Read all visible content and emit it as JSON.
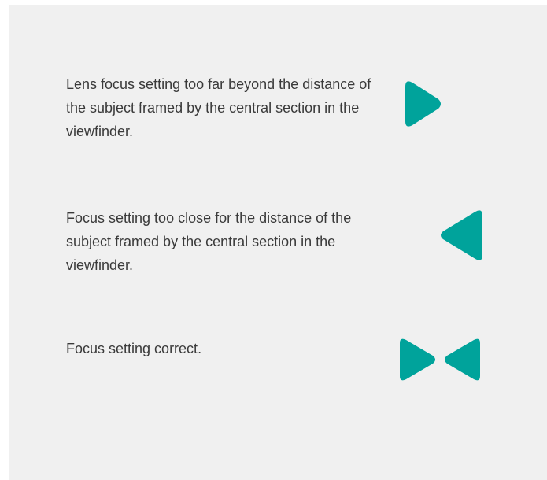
{
  "accent_color": "#00a39b",
  "items": [
    {
      "text": "Lens focus setting too far beyond the distance of the subject framed by the central section in the viewfinder.",
      "indicator": "triangle-right-icon"
    },
    {
      "text": "Focus setting too close for the distance of the subject framed by the central section in the viewfinder.",
      "indicator": "triangle-left-icon"
    },
    {
      "text": "Focus setting correct.",
      "indicator": "triangles-converging-icon"
    }
  ]
}
